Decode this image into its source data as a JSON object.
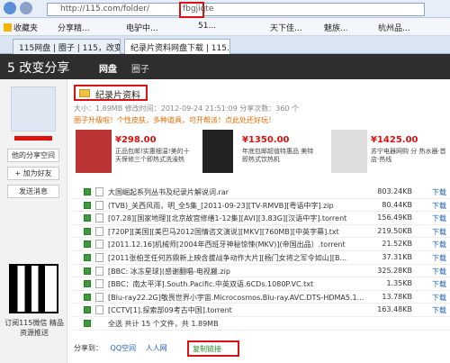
{
  "browser": {
    "url": "http://115.com/folder/",
    "url_highlight": "fbgjiqte",
    "favorites_label": "收藏夹",
    "favorites": [
      "分享精...",
      "电驴中...",
      "51...",
      "天下佳...",
      "魅族...",
      "杭州品..."
    ],
    "tabs": [
      "115网盘 | 圈子 | 115，改变...",
      "纪录片资料网盘下载 | 115..."
    ]
  },
  "site": {
    "logo": "5 改变分享",
    "nav": [
      "网盘",
      "圈子"
    ]
  },
  "sidebar": {
    "buttons": [
      "他的分享空间",
      "+ 加为好友",
      "发送消息"
    ],
    "qr_text": "订阅115微信\n精品资源推送"
  },
  "folder": {
    "title": "纪录片资料",
    "meta": "大小：1.89MB   修改时间：2012-09-24 21:51:09   分享次数：360 个",
    "promo": "圈子升级啦！个性皮肤，多种道具，可开帮派！点此处还好玩！"
  },
  "ads": [
    {
      "price": "¥298.00",
      "desc": "正品包邮!实惠细温!美的十天保修三个即热式洗澡热"
    },
    {
      "price": "¥1350.00",
      "desc": "年底包邮超值特惠品 美特即热式饮热机"
    },
    {
      "price": "¥1425.00",
      "desc": "苏宁电器网购 分 热水器·首店·热线"
    }
  ],
  "files": [
    {
      "name": "大国崛起系列丛书及纪录片解说词.rar",
      "size": "803.24KB"
    },
    {
      "name": "(TVB)_关西风雨，明_全5集_[2011-09-23][TV-RMVB][粤语中字].zip",
      "size": "80.44KB"
    },
    {
      "name": "[07.28][国家地理][北京故宫修缮1-12集][AVI][3.83G][汉语中字].torrent",
      "size": "156.49KB"
    },
    {
      "name": "[720P][美国][美巴马2012国情咨文演说][MKV][760MB][中英字幕].txt",
      "size": "219.50KB"
    },
    {
      "name": "[2011.12.16]机械师[2004年西班牙神秘惊悚(MKV)](帝国出品）.torrent",
      "size": "21.52KB"
    },
    {
      "name": "[2011张柏芝任何苏鼎新上映含拔战争动作大片][杨门女将之军令如山][B...",
      "size": "37.31KB"
    },
    {
      "name": "[BBC: 冰冻星球](感谢翻唱-电视搬.zip",
      "size": "325.28KB"
    },
    {
      "name": "[BBC：南太平洋].South.Pacific.中英双语.6CDs.1080P.VC.txt",
      "size": "1.35KB"
    },
    {
      "name": "[Blu-ray22.2G]敬畏世界小宇宙.Microcosmos.Blu-ray.AVC.DTS-HDMA5.1...",
      "size": "13.78KB"
    },
    {
      "name": "[CCTV[1].探索部09考古中国].torrent",
      "size": "163.48KB"
    }
  ],
  "download_label": "下载",
  "summary": "全选 共计 15 个文件，共 1.89MB",
  "share": {
    "label": "分享到：",
    "qq": "QQ空间",
    "renren": "人人网",
    "copy": "复制链接"
  }
}
